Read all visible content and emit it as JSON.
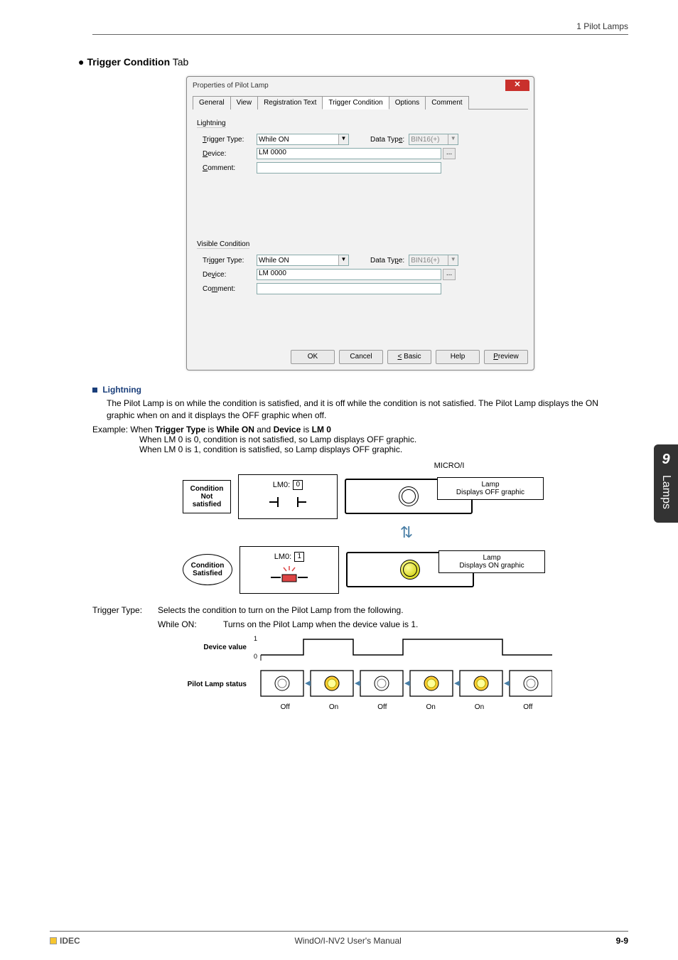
{
  "header": {
    "section": "1 Pilot Lamps"
  },
  "chapter": {
    "number": "9",
    "name": "Lamps"
  },
  "title": {
    "bullet": "●",
    "bold": "Trigger Condition",
    "normal": " Tab"
  },
  "dialog": {
    "title": "Properties of Pilot Lamp",
    "tabs": [
      "General",
      "View",
      "Registration Text",
      "Trigger Condition",
      "Options",
      "Comment"
    ],
    "group1": {
      "name": "Lightning",
      "trigger_label": "Trigger Type:",
      "trigger_value": "While ON",
      "datatype_label": "Data Type:",
      "datatype_value": "BIN16(+)",
      "device_label": "Device:",
      "device_value": "LM 0000",
      "comment_label": "Comment:"
    },
    "group2": {
      "name": "Visible Condition",
      "trigger_label": "Trigger Type:",
      "trigger_value": "While ON",
      "datatype_label": "Data Type:",
      "datatype_value": "BIN16(+)",
      "device_label": "Device:",
      "device_value": "LM 0000",
      "comment_label": "Comment:"
    },
    "buttons": {
      "ok": "OK",
      "cancel": "Cancel",
      "basic": "< Basic",
      "help": "Help",
      "preview": "Preview"
    }
  },
  "lightning": {
    "title": "Lightning",
    "para": "The Pilot Lamp is on while the condition is satisfied, and it is off while the condition is not satisfied. The Pilot Lamp displays the ON graphic when on and it displays the OFF graphic when off.",
    "example_prefix": "Example: When ",
    "example_bold1": "Trigger Type",
    "example_mid1": " is ",
    "example_bold2": "While ON",
    "example_mid2": " and ",
    "example_bold3": "Device",
    "example_mid3": " is ",
    "example_bold4": "LM 0",
    "line1": "When LM 0 is 0, condition is not satisfied, so Lamp displays OFF graphic.",
    "line2": "When LM 0 is 1, condition is satisfied, so Lamp displays OFF graphic."
  },
  "diagram1": {
    "micro": "MICRO/I",
    "cond_not_l1": "Condition",
    "cond_not_l2": "Not satisfied",
    "cond_sat_l1": "Condition",
    "cond_sat_l2": "Satisfied",
    "lm_label": "LM0:",
    "lm0": "0",
    "lm1": "1",
    "lamp_label": "Lamp",
    "off_text": "Displays OFF graphic",
    "on_text": "Displays ON graphic"
  },
  "trigger_def": {
    "term": "Trigger Type:",
    "desc": "Selects the condition to turn on the Pilot Lamp from the following.",
    "while_on_term": "While ON:",
    "while_on_desc": "Turns on the Pilot Lamp when the device value is 1."
  },
  "diagram2": {
    "device_label": "Device value",
    "status_label": "Pilot Lamp status",
    "tick1": "1",
    "tick0": "0",
    "states": [
      "Off",
      "On",
      "Off",
      "On",
      "On",
      "Off"
    ]
  },
  "footer": {
    "logo": "IDEC",
    "center": "WindO/I-NV2 User's Manual",
    "page": "9-9"
  }
}
